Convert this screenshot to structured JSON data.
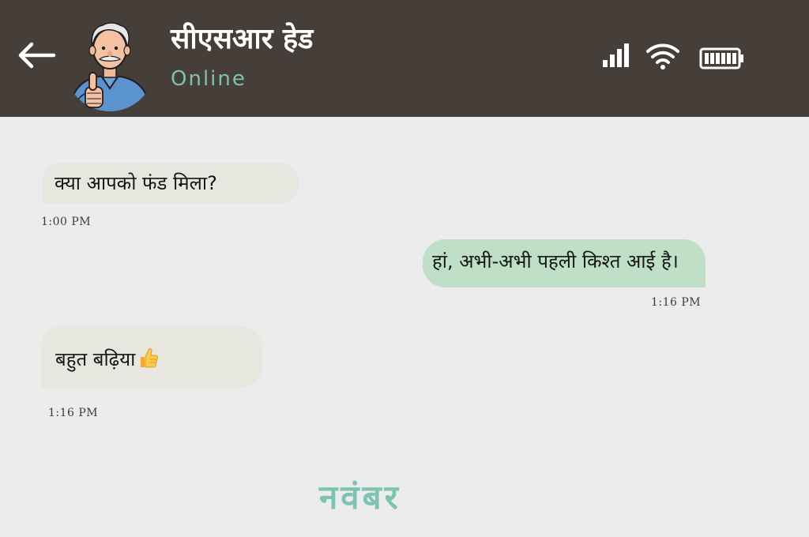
{
  "header": {
    "contact_name": "सीएसआर हेड",
    "status": "Online",
    "back_icon": "arrow-left-icon",
    "avatar": "avatar-elderly-man-thumbs-up",
    "icons": [
      "signal-icon",
      "wifi-icon",
      "battery-icon"
    ]
  },
  "messages": [
    {
      "direction": "incoming",
      "text": "क्या आपको फंड मिला?",
      "time": "1:00 PM"
    },
    {
      "direction": "outgoing",
      "text": "हां, अभी-अभी पहली किश्त आई है।",
      "time": "1:16 PM"
    },
    {
      "direction": "incoming",
      "text": "बहुत बढ़िया",
      "emoji": "thumbs-up-icon",
      "time": "1:16 PM"
    }
  ],
  "footer": {
    "month_label": "नवंबर"
  },
  "colors": {
    "header_bg": "#463e39",
    "status_green": "#7cc3a8",
    "incoming_bubble": "#e7e6df",
    "outgoing_bubble": "#bfe0c6",
    "chat_bg": "#ececec",
    "month_teal": "#7cc3b4"
  }
}
